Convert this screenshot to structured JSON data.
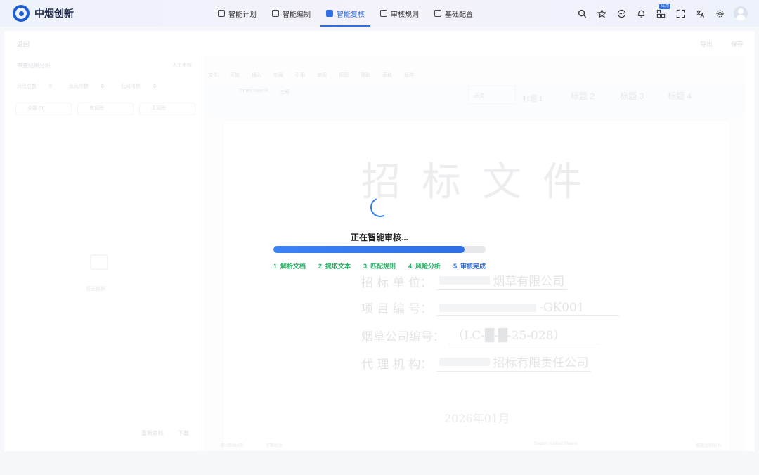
{
  "brand": {
    "name": "中烟创新"
  },
  "nav": {
    "items": [
      {
        "label": "智能计划",
        "active": false
      },
      {
        "label": "智能编制",
        "active": false
      },
      {
        "label": "智能复核",
        "active": true
      },
      {
        "label": "审核规则",
        "active": false
      },
      {
        "label": "基础配置",
        "active": false
      }
    ]
  },
  "toolbar": {
    "apps_badge": "应用"
  },
  "background": {
    "title": "返回",
    "actions": [
      "导出",
      "保存"
    ],
    "left_panel": {
      "heading": "审查结果分析",
      "heading_right": "人工审核",
      "stats": [
        {
          "label": "风险总数",
          "value": "0"
        },
        {
          "label": "高风险数",
          "value": "0"
        },
        {
          "label": "低风险数",
          "value": "0"
        }
      ],
      "filters": [
        "全部 (0)",
        "有风险",
        "无风险"
      ],
      "empty_text": "暂无数据",
      "bottom_actions": [
        "重新审核",
        "下载"
      ]
    },
    "editor": {
      "menu": [
        "文件",
        "开始",
        "插入",
        "布局",
        "引用",
        "审阅",
        "视图",
        "帮助",
        "表格",
        "插件"
      ],
      "font_name": "Times New R",
      "font_size": "三号",
      "style_box": "正文",
      "headings": [
        "标题 1",
        "标题 2",
        "标题 3",
        "标题 4"
      ]
    },
    "document": {
      "title": "招标文件",
      "lines": [
        {
          "label": "招 标 单 位：",
          "value": "烟草有限公司"
        },
        {
          "label": "项 目 编 号：",
          "value": "-GK001"
        },
        {
          "label": "烟草公司编号：",
          "value": "（LC-█-█-25-028）"
        },
        {
          "label": "代 理 机 构：",
          "value": "招标有限责任公司"
        }
      ],
      "date": "2026年01月"
    },
    "statusbar": {
      "page": "第1页/共6页",
      "words": "字数统计",
      "language": "English (United States)",
      "zoom": "缩放比例87%"
    }
  },
  "loading": {
    "title": "正在智能审核...",
    "progress": 0.9,
    "steps": [
      {
        "label": "1. 解析文档",
        "state": "done"
      },
      {
        "label": "2. 提取文本",
        "state": "done"
      },
      {
        "label": "3. 匹配规则",
        "state": "done"
      },
      {
        "label": "4. 风险分析",
        "state": "done"
      },
      {
        "label": "5. 审核完成",
        "state": "current"
      }
    ],
    "colors": {
      "done": "#2aae67",
      "current": "#2f6fe4",
      "bar": "#2f6fe4"
    }
  }
}
